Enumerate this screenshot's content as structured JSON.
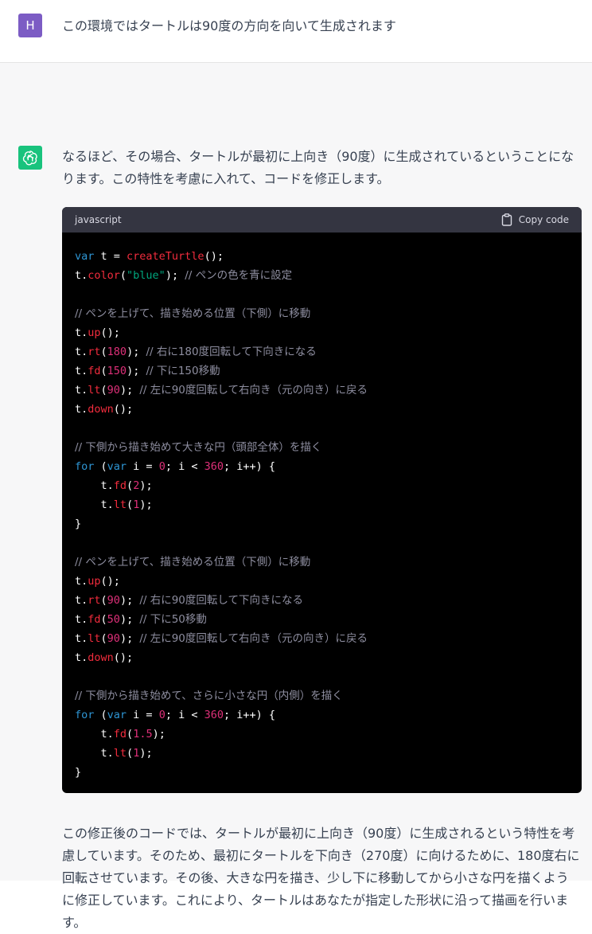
{
  "user_message": {
    "avatar_letter": "H",
    "text": "この環境ではタートルは90度の方向を向いて生成されます"
  },
  "assistant_message": {
    "intro": "なるほど、その場合、タートルが最初に上向き（90度）に生成されているということになります。この特性を考慮に入れて、コードを修正します。",
    "code": {
      "language": "javascript",
      "copy_label": "Copy code",
      "lines": [
        [
          {
            "t": "var",
            "c": "kw"
          },
          {
            "t": " t = "
          },
          {
            "t": "createTurtle",
            "c": "fn"
          },
          {
            "t": "();"
          }
        ],
        [
          {
            "t": "t."
          },
          {
            "t": "color",
            "c": "fn"
          },
          {
            "t": "("
          },
          {
            "t": "\"blue\"",
            "c": "str"
          },
          {
            "t": "); "
          },
          {
            "t": "// ペンの色を青に設定",
            "c": "cm"
          }
        ],
        [],
        [
          {
            "t": "// ペンを上げて、描き始める位置（下側）に移動",
            "c": "cm"
          }
        ],
        [
          {
            "t": "t."
          },
          {
            "t": "up",
            "c": "fn"
          },
          {
            "t": "();"
          }
        ],
        [
          {
            "t": "t."
          },
          {
            "t": "rt",
            "c": "fn"
          },
          {
            "t": "("
          },
          {
            "t": "180",
            "c": "num"
          },
          {
            "t": "); "
          },
          {
            "t": "// 右に180度回転して下向きになる",
            "c": "cm"
          }
        ],
        [
          {
            "t": "t."
          },
          {
            "t": "fd",
            "c": "fn"
          },
          {
            "t": "("
          },
          {
            "t": "150",
            "c": "num"
          },
          {
            "t": "); "
          },
          {
            "t": "// 下に150移動",
            "c": "cm"
          }
        ],
        [
          {
            "t": "t."
          },
          {
            "t": "lt",
            "c": "fn"
          },
          {
            "t": "("
          },
          {
            "t": "90",
            "c": "num"
          },
          {
            "t": "); "
          },
          {
            "t": "// 左に90度回転して右向き（元の向き）に戻る",
            "c": "cm"
          }
        ],
        [
          {
            "t": "t."
          },
          {
            "t": "down",
            "c": "fn"
          },
          {
            "t": "();"
          }
        ],
        [],
        [
          {
            "t": "// 下側から描き始めて大きな円（頭部全体）を描く",
            "c": "cm"
          }
        ],
        [
          {
            "t": "for",
            "c": "kw"
          },
          {
            "t": " ("
          },
          {
            "t": "var",
            "c": "kw"
          },
          {
            "t": " i = "
          },
          {
            "t": "0",
            "c": "num"
          },
          {
            "t": "; i < "
          },
          {
            "t": "360",
            "c": "num"
          },
          {
            "t": "; i++) {"
          }
        ],
        [
          {
            "t": "    t."
          },
          {
            "t": "fd",
            "c": "fn"
          },
          {
            "t": "("
          },
          {
            "t": "2",
            "c": "num"
          },
          {
            "t": ");"
          }
        ],
        [
          {
            "t": "    t."
          },
          {
            "t": "lt",
            "c": "fn"
          },
          {
            "t": "("
          },
          {
            "t": "1",
            "c": "num"
          },
          {
            "t": ");"
          }
        ],
        [
          {
            "t": "}"
          }
        ],
        [],
        [
          {
            "t": "// ペンを上げて、描き始める位置（下側）に移動",
            "c": "cm"
          }
        ],
        [
          {
            "t": "t."
          },
          {
            "t": "up",
            "c": "fn"
          },
          {
            "t": "();"
          }
        ],
        [
          {
            "t": "t."
          },
          {
            "t": "rt",
            "c": "fn"
          },
          {
            "t": "("
          },
          {
            "t": "90",
            "c": "num"
          },
          {
            "t": "); "
          },
          {
            "t": "// 右に90度回転して下向きになる",
            "c": "cm"
          }
        ],
        [
          {
            "t": "t."
          },
          {
            "t": "fd",
            "c": "fn"
          },
          {
            "t": "("
          },
          {
            "t": "50",
            "c": "num"
          },
          {
            "t": "); "
          },
          {
            "t": "// 下に50移動",
            "c": "cm"
          }
        ],
        [
          {
            "t": "t."
          },
          {
            "t": "lt",
            "c": "fn"
          },
          {
            "t": "("
          },
          {
            "t": "90",
            "c": "num"
          },
          {
            "t": "); "
          },
          {
            "t": "// 左に90度回転して右向き（元の向き）に戻る",
            "c": "cm"
          }
        ],
        [
          {
            "t": "t."
          },
          {
            "t": "down",
            "c": "fn"
          },
          {
            "t": "();"
          }
        ],
        [],
        [
          {
            "t": "// 下側から描き始めて、さらに小さな円（内側）を描く",
            "c": "cm"
          }
        ],
        [
          {
            "t": "for",
            "c": "kw"
          },
          {
            "t": " ("
          },
          {
            "t": "var",
            "c": "kw"
          },
          {
            "t": " i = "
          },
          {
            "t": "0",
            "c": "num"
          },
          {
            "t": "; i < "
          },
          {
            "t": "360",
            "c": "num"
          },
          {
            "t": "; i++) {"
          }
        ],
        [
          {
            "t": "    t."
          },
          {
            "t": "fd",
            "c": "fn"
          },
          {
            "t": "("
          },
          {
            "t": "1.5",
            "c": "num"
          },
          {
            "t": ");"
          }
        ],
        [
          {
            "t": "    t."
          },
          {
            "t": "lt",
            "c": "fn"
          },
          {
            "t": "("
          },
          {
            "t": "1",
            "c": "num"
          },
          {
            "t": ");"
          }
        ],
        [
          {
            "t": "}"
          }
        ]
      ]
    },
    "outro": "この修正後のコードでは、タートルが最初に上向き（90度）に生成されるという特性を考慮しています。そのため、最初にタートルを下向き（270度）に向けるために、180度右に回転させています。その後、大きな円を描き、少し下に移動してから小さな円を描くように修正しています。これにより、タートルはあなたが指定した形状に沿って描画を行います。"
  },
  "colors": {
    "user_avatar": "#7c5cc4",
    "assistant_avatar": "#19c37d",
    "code_bg": "#000000",
    "code_header_bg": "#343541",
    "keyword": "#2e95d3",
    "function": "#f22c3d",
    "string": "#00a67d",
    "number": "#df3079",
    "comment": "#8e8ea0"
  },
  "icons": {
    "assistant_avatar": "openai-logo-icon",
    "copy": "clipboard-icon"
  }
}
